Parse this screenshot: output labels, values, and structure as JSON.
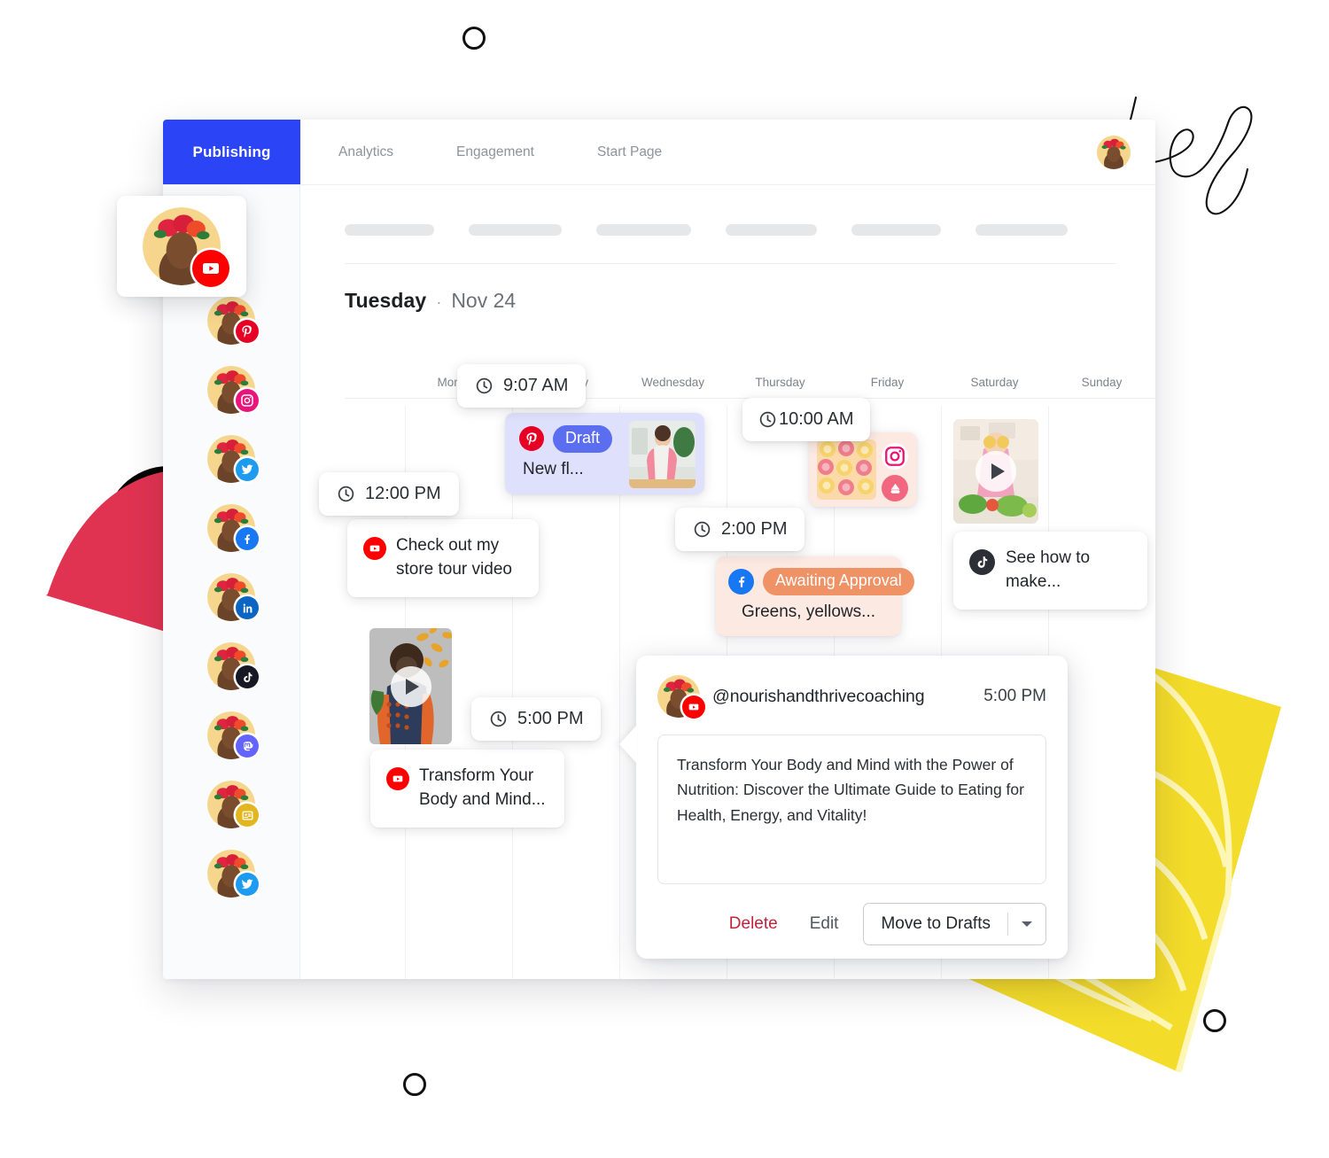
{
  "app": {
    "nav": {
      "primary": "Publishing",
      "tabs": [
        "Analytics",
        "Engagement",
        "Start Page"
      ]
    },
    "day_header": {
      "weekday": "Tuesday",
      "separator": "·",
      "date": "Nov 24"
    },
    "calendar": {
      "day_labels": [
        "Monday",
        "Tuesday",
        "Wednesday",
        "Thursday",
        "Friday",
        "Saturday",
        "Sunday"
      ]
    }
  },
  "accounts": [
    {
      "network": "youtube",
      "label": "YouTube account",
      "color": "#ff0000"
    },
    {
      "network": "pinterest",
      "label": "Pinterest account",
      "color": "#e60023"
    },
    {
      "network": "instagram",
      "label": "Instagram account",
      "color": "#e8157a"
    },
    {
      "network": "twitter",
      "label": "Twitter account",
      "color": "#1d9bf0"
    },
    {
      "network": "facebook",
      "label": "Facebook account",
      "color": "#1877f2"
    },
    {
      "network": "linkedin",
      "label": "LinkedIn account",
      "color": "#0a66c2"
    },
    {
      "network": "tiktok",
      "label": "TikTok account",
      "color": "#161823"
    },
    {
      "network": "mastodon",
      "label": "Mastodon account",
      "color": "#6364ff"
    },
    {
      "network": "google-business",
      "label": "Google Business Profile account",
      "color": "#e3b51f"
    },
    {
      "network": "twitter",
      "label": "Twitter account",
      "color": "#1d9bf0"
    }
  ],
  "posts": [
    {
      "id": "p1",
      "time": "9:07 AM",
      "network": "pinterest",
      "status": "Draft",
      "text": "New fl...",
      "has_thumb": true
    },
    {
      "id": "p2",
      "time": "12:00 PM",
      "network": "youtube",
      "text": "Check out my store tour video"
    },
    {
      "id": "p3",
      "time": "10:00 AM",
      "network": "instagram",
      "has_thumb": true
    },
    {
      "id": "p4",
      "time": "2:00 PM",
      "network": "facebook",
      "status": "Awaiting Approval",
      "text": "Greens, yellows..."
    },
    {
      "id": "p5",
      "network": "tiktok",
      "text": "See how to make...",
      "has_thumb": true
    },
    {
      "id": "p6",
      "time": "5:00 PM",
      "network": "youtube",
      "text": "Transform Your Body and Mind...",
      "has_thumb": true
    }
  ],
  "detail": {
    "handle": "@nourishandthrivecoaching",
    "time": "5:00 PM",
    "network": "youtube",
    "body": "Transform Your Body and Mind with the Power of Nutrition: Discover the Ultimate Guide to Eating for Health, Energy, and Vitality!",
    "actions": {
      "delete": "Delete",
      "edit": "Edit",
      "primary": "Move to Drafts"
    }
  },
  "colors": {
    "accent": "#2b44f5",
    "draft_badge": "#5b6ef0",
    "approval_badge": "#ef9265",
    "delete": "#c0243c",
    "deco_red": "#e03352",
    "deco_yellow": "#f4dc2a"
  }
}
